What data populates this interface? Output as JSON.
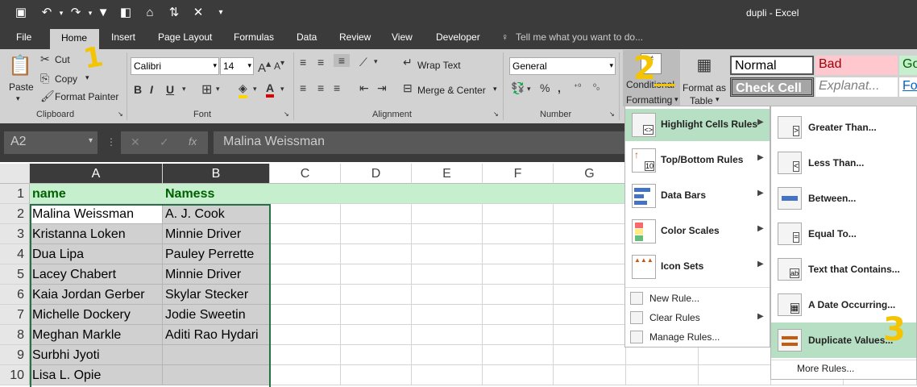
{
  "app": {
    "window_title": "dupli - Excel"
  },
  "menu": {
    "tabs": [
      "File",
      "Home",
      "Insert",
      "Page Layout",
      "Formulas",
      "Data",
      "Review",
      "View",
      "Developer"
    ],
    "tell_me": "Tell me what you want to do..."
  },
  "ribbon": {
    "clipboard": {
      "paste": "Paste",
      "cut": "Cut",
      "copy": "Copy",
      "format_painter": "Format Painter",
      "label": "Clipboard"
    },
    "font": {
      "name": "Calibri",
      "size": "14",
      "label": "Font"
    },
    "alignment": {
      "wrap_text": "Wrap Text",
      "merge_center": "Merge & Center",
      "label": "Alignment"
    },
    "number": {
      "format": "General",
      "label": "Number"
    },
    "styles": {
      "conditional_formatting_line1": "Conditional",
      "conditional_formatting_line2": "Formatting",
      "format_as_table_line1": "Format as",
      "format_as_table_line2": "Table",
      "normal": "Normal",
      "bad": "Bad",
      "good": "Go",
      "check_cell": "Check Cell",
      "explanatory": "Explanat...",
      "fo": "Fo"
    }
  },
  "formula_bar": {
    "name_box": "A2",
    "fx": "fx",
    "formula": "Malina Weissman"
  },
  "sheet": {
    "columns": [
      "A",
      "B",
      "C",
      "D",
      "E",
      "F",
      "G"
    ],
    "rows": [
      {
        "num": "1",
        "a": "name",
        "b": "Namess"
      },
      {
        "num": "2",
        "a": "Malina Weissman",
        "b": "A. J. Cook"
      },
      {
        "num": "3",
        "a": "Kristanna Loken",
        "b": "Minnie Driver"
      },
      {
        "num": "4",
        "a": "Dua Lipa",
        "b": "Pauley Perrette"
      },
      {
        "num": "5",
        "a": "Lacey Chabert",
        "b": "Minnie Driver"
      },
      {
        "num": "6",
        "a": "Kaia Jordan Gerber",
        "b": "Skylar Stecker"
      },
      {
        "num": "7",
        "a": "Michelle Dockery",
        "b": "Jodie Sweetin"
      },
      {
        "num": "8",
        "a": "Meghan Markle",
        "b": "Aditi Rao Hydari"
      },
      {
        "num": "9",
        "a": "Surbhi Jyoti",
        "b": ""
      },
      {
        "num": "10",
        "a": "Lisa L. Opie",
        "b": ""
      }
    ]
  },
  "cf_menu": {
    "items": [
      "Highlight Cells Rules",
      "Top/Bottom Rules",
      "Data Bars",
      "Color Scales",
      "Icon Sets"
    ],
    "bottom_items": [
      "New Rule...",
      "Clear Rules",
      "Manage Rules..."
    ]
  },
  "highlight_submenu": {
    "items": [
      "Greater Than...",
      "Less Than...",
      "Between...",
      "Equal To...",
      "Text that Contains...",
      "A Date Occurring...",
      "Duplicate Values..."
    ],
    "more_rules": "More Rules..."
  },
  "annotations": [
    "1",
    "2",
    "3"
  ],
  "colors": {
    "dark_chrome": "#3b3b3b",
    "ribbon": "#d2d2d2",
    "header_row": "#c6efce",
    "header_text": "#006100",
    "highlight": "#b7dfc3",
    "annotation": "#f5c400"
  }
}
